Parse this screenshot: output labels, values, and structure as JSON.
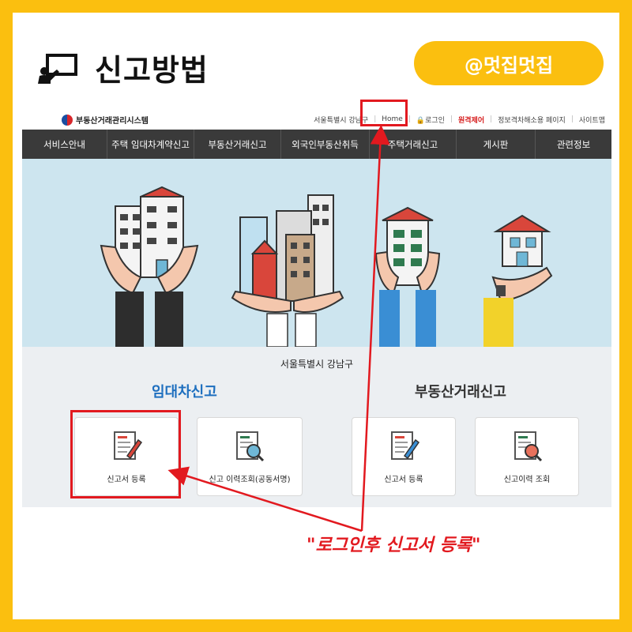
{
  "header": {
    "title": "신고방법",
    "handle": "@멋집멋집"
  },
  "site": {
    "logo": "부동산거래관리시스템",
    "top_links": [
      "서울특별시 강남구",
      "Home",
      "🔒로그인",
      "원격제어",
      "정보격차해소용 페이지",
      "사이트맵"
    ],
    "nav": [
      "서비스안내",
      "주택 임대차계약신고",
      "부동산거래신고",
      "외국인부동산취득",
      "주택거래신고",
      "게시판",
      "관련정보"
    ]
  },
  "main": {
    "district": "서울특별시 강남구",
    "lease_section": "임대차신고",
    "trade_section": "부동산거래신고",
    "cards": [
      {
        "label": "신고서 등록"
      },
      {
        "label": "신고 이력조회(공동서명)"
      },
      {
        "label": "신고서 등록"
      },
      {
        "label": "신고이력 조회"
      }
    ]
  },
  "annotation": {
    "caption": "\"로그인후 신고서 등록\""
  },
  "colors": {
    "frame": "#fbbf0f",
    "nav": "#3a3a3a",
    "banner": "#cde5ef",
    "highlight": "#e2191f",
    "lease_title": "#1e6fbf"
  }
}
